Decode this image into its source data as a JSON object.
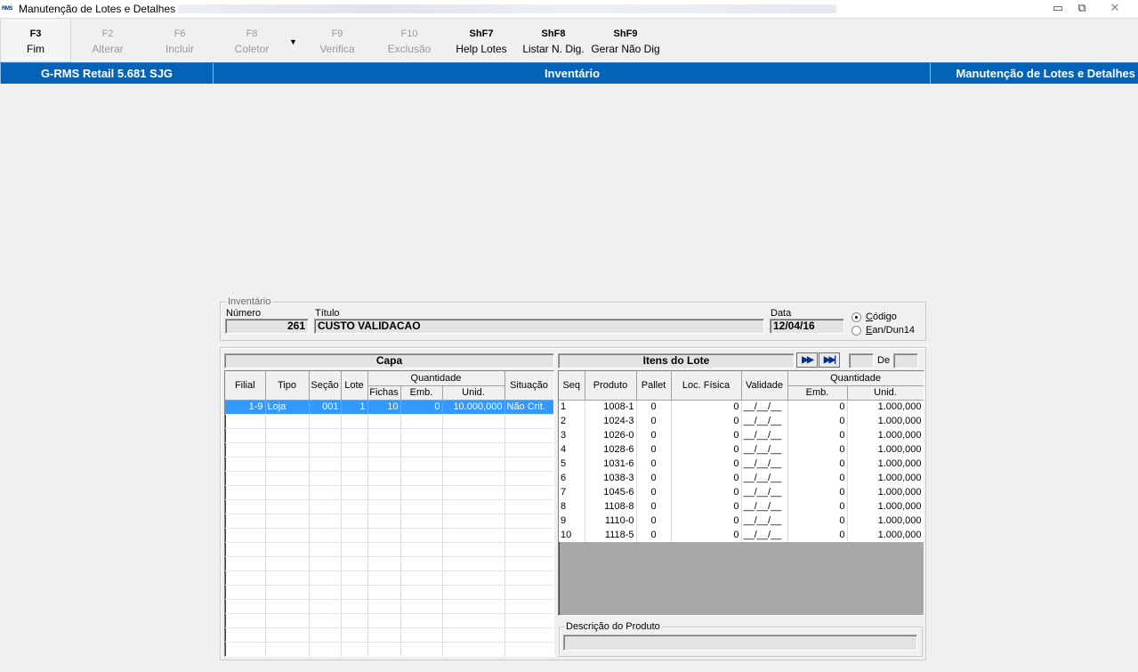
{
  "window": {
    "title": "Manutenção de Lotes e Detalhes",
    "app_icon_text": "RMS",
    "min_glyph": "▭",
    "max_glyph": "⧉",
    "close_glyph": "✕"
  },
  "toolbar": [
    {
      "key": "F3",
      "label": "Fim",
      "enabled": true
    },
    {
      "key": "F2",
      "label": "Alterar",
      "enabled": false
    },
    {
      "key": "F6",
      "label": "Incluir",
      "enabled": false
    },
    {
      "key": "F8",
      "label": "Coletor",
      "enabled": false
    },
    {
      "key": "F9",
      "label": "Verifica",
      "enabled": false
    },
    {
      "key": "F10",
      "label": "Exclusão",
      "enabled": false
    },
    {
      "key": "ShF7",
      "label": "Help Lotes",
      "enabled": true
    },
    {
      "key": "ShF8",
      "label": "Listar N. Dig.",
      "enabled": true
    },
    {
      "key": "ShF9",
      "label": "Gerar Não Dig",
      "enabled": true
    }
  ],
  "coletor_dropdown_icon": "▼",
  "header": {
    "system": "G-RMS Retail 5.681 SJG",
    "module": "Inventário",
    "screen": "Manutenção de Lotes e Detalhes"
  },
  "inventario": {
    "group_label": "Inventário",
    "numero_label": "Número",
    "numero": "261",
    "titulo_label": "Título",
    "titulo": "CUSTO VALIDACAO",
    "data_label": "Data",
    "data": "12/04/16",
    "radio_codigo": "Código",
    "radio_ean": "Ean/Dun14",
    "selected": "codigo"
  },
  "capa": {
    "title": "Capa",
    "headers": {
      "filial": "Filial",
      "tipo": "Tipo",
      "secao": "Seção",
      "lote": "Lote",
      "quantidade": "Quantidade",
      "fichas": "Fichas",
      "emb": "Emb.",
      "unid": "Unid.",
      "situacao": "Situação"
    },
    "rows": [
      {
        "filial": "1-9",
        "tipo": "Loja",
        "secao": "001",
        "lote": "1",
        "fichas": "10",
        "emb": "0",
        "unid": "10.000,000",
        "situacao": "Não Crit."
      }
    ]
  },
  "itens": {
    "title": "Itens do Lote",
    "next_icon": "▶▶",
    "last_icon": "▶▶|",
    "page_current": "",
    "de_label": "De",
    "page_total": "",
    "headers": {
      "seq": "Seq",
      "produto": "Produto",
      "pallet": "Pallet",
      "loc": "Loc. Física",
      "validade": "Validade",
      "quantidade": "Quantidade",
      "emb": "Emb.",
      "unid": "Unid."
    },
    "rows": [
      {
        "seq": "1",
        "produto": "1008-1",
        "pallet": "0",
        "loc": "0",
        "validade": "__/__/__",
        "emb": "0",
        "unid": "1.000,000"
      },
      {
        "seq": "2",
        "produto": "1024-3",
        "pallet": "0",
        "loc": "0",
        "validade": "__/__/__",
        "emb": "0",
        "unid": "1.000,000"
      },
      {
        "seq": "3",
        "produto": "1026-0",
        "pallet": "0",
        "loc": "0",
        "validade": "__/__/__",
        "emb": "0",
        "unid": "1.000,000"
      },
      {
        "seq": "4",
        "produto": "1028-6",
        "pallet": "0",
        "loc": "0",
        "validade": "__/__/__",
        "emb": "0",
        "unid": "1.000,000"
      },
      {
        "seq": "5",
        "produto": "1031-6",
        "pallet": "0",
        "loc": "0",
        "validade": "__/__/__",
        "emb": "0",
        "unid": "1.000,000"
      },
      {
        "seq": "6",
        "produto": "1038-3",
        "pallet": "0",
        "loc": "0",
        "validade": "__/__/__",
        "emb": "0",
        "unid": "1.000,000"
      },
      {
        "seq": "7",
        "produto": "1045-6",
        "pallet": "0",
        "loc": "0",
        "validade": "__/__/__",
        "emb": "0",
        "unid": "1.000,000"
      },
      {
        "seq": "8",
        "produto": "1108-8",
        "pallet": "0",
        "loc": "0",
        "validade": "__/__/__",
        "emb": "0",
        "unid": "1.000,000"
      },
      {
        "seq": "9",
        "produto": "1110-0",
        "pallet": "0",
        "loc": "0",
        "validade": "__/__/__",
        "emb": "0",
        "unid": "1.000,000"
      },
      {
        "seq": "10",
        "produto": "1118-5",
        "pallet": "0",
        "loc": "0",
        "validade": "__/__/__",
        "emb": "0",
        "unid": "1.000,000"
      }
    ]
  },
  "descricao": {
    "label": "Descrição do Produto",
    "value": ""
  }
}
